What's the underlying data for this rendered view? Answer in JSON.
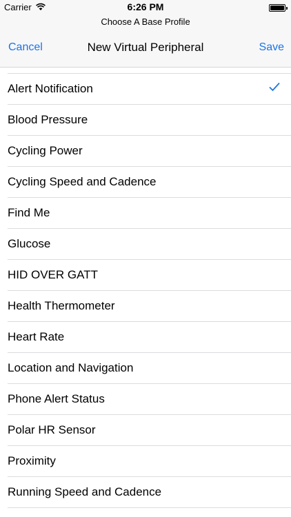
{
  "status_bar": {
    "carrier": "Carrier",
    "time": "6:26 PM"
  },
  "prompt": "Choose A Base Profile",
  "nav": {
    "cancel": "Cancel",
    "title": "New Virtual Peripheral",
    "save": "Save"
  },
  "accent_color": "#1a73e8",
  "profiles": [
    {
      "label": "Alert Notification",
      "selected": true
    },
    {
      "label": "Blood Pressure"
    },
    {
      "label": "Cycling Power"
    },
    {
      "label": "Cycling Speed and Cadence"
    },
    {
      "label": "Find Me"
    },
    {
      "label": "Glucose"
    },
    {
      "label": "HID OVER GATT"
    },
    {
      "label": "Health Thermometer"
    },
    {
      "label": "Heart Rate"
    },
    {
      "label": "Location and Navigation"
    },
    {
      "label": "Phone Alert Status"
    },
    {
      "label": "Polar HR Sensor"
    },
    {
      "label": "Proximity"
    },
    {
      "label": "Running Speed and Cadence"
    }
  ]
}
